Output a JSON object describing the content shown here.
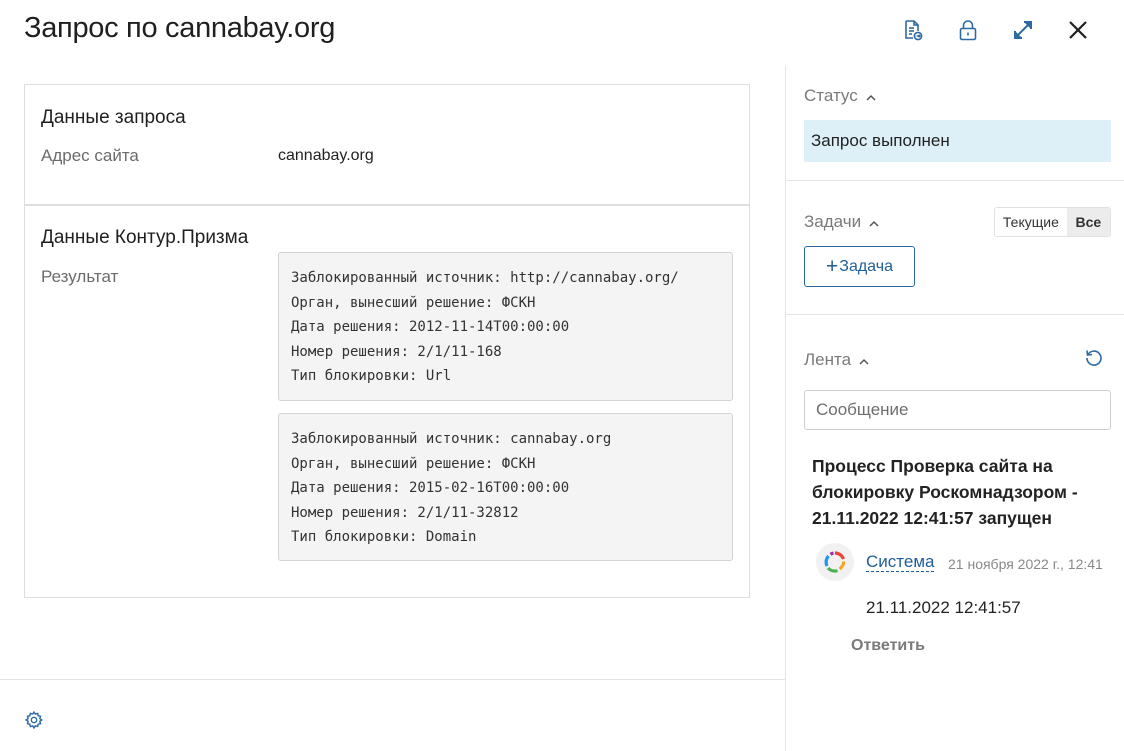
{
  "header": {
    "title": "Запрос по cannabay.org"
  },
  "request_card": {
    "title": "Данные запроса",
    "site_label": "Адрес сайта",
    "site_value": "cannabay.org"
  },
  "prizma_card": {
    "title": "Данные Контур.Призма",
    "result_label": "Результат",
    "results": [
      "Заблокированный источник: http://cannabay.org/\nОрган, вынесший решение: ФСКН\nДата решения: 2012-11-14T00:00:00\nНомер решения: 2/1/11-168\nТип блокировки: Url",
      "Заблокированный источник: cannabay.org\nОрган, вынесший решение: ФСКН\nДата решения: 2015-02-16T00:00:00\nНомер решения: 2/1/11-32812\nТип блокировки: Domain"
    ]
  },
  "sidebar": {
    "status": {
      "label": "Статус",
      "value": "Запрос выполнен"
    },
    "tasks": {
      "label": "Задачи",
      "toggle_current": "Текущие",
      "toggle_all": "Все",
      "add_label": "Задача"
    },
    "feed": {
      "label": "Лента",
      "message_placeholder": "Сообщение",
      "post_title": "Процесс Проверка сайта на блокировку Роскомнадзором - 21.11.2022 12:41:57 запущен",
      "author": "Система",
      "time": "21 ноября 2022 г., 12:41",
      "text": "21.11.2022 12:41:57",
      "reply_label": "Ответить"
    }
  },
  "colors": {
    "accent": "#1f5e98",
    "status_bg": "#ddf0f8"
  }
}
